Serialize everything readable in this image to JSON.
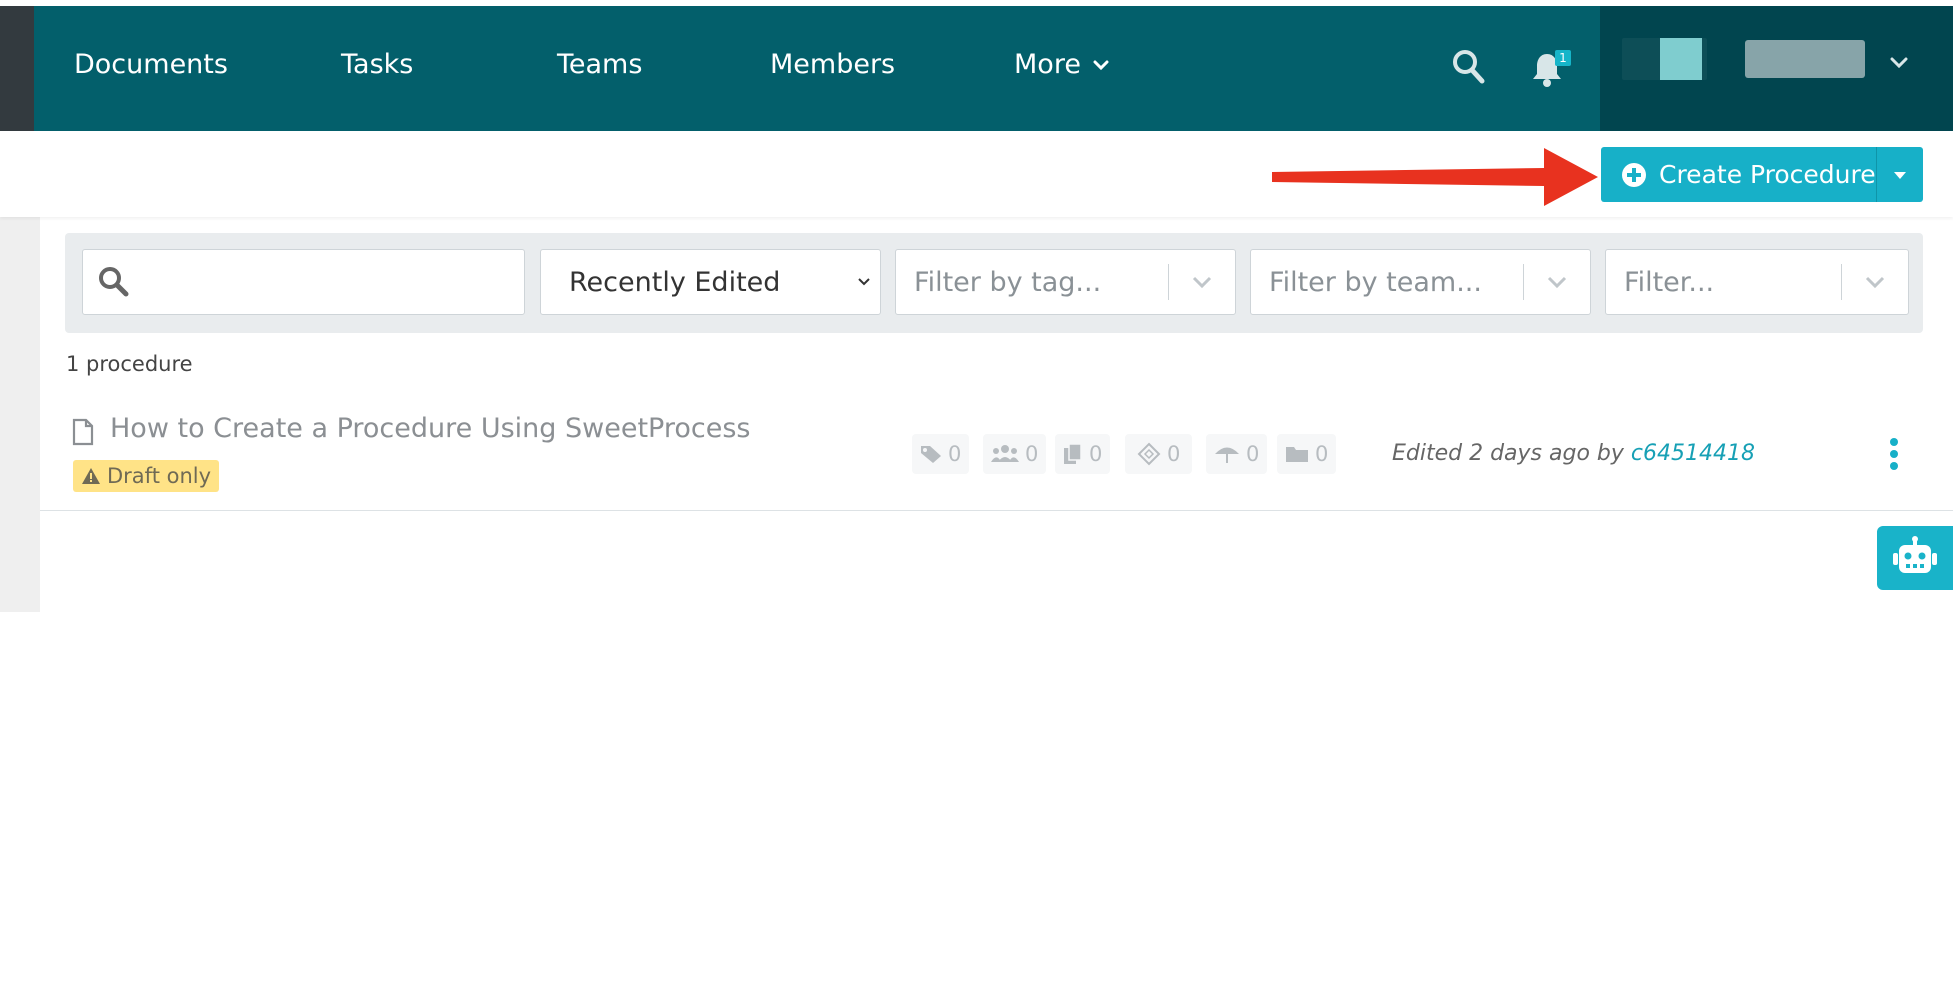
{
  "nav": {
    "items": [
      {
        "label": "Documents"
      },
      {
        "label": "Tasks"
      },
      {
        "label": "Teams"
      },
      {
        "label": "Members"
      }
    ],
    "more_label": "More",
    "notification_count": "1"
  },
  "toolbar": {
    "create_label": "Create Procedure"
  },
  "filters": {
    "search_placeholder": "",
    "sort_value": "Recently Edited",
    "tag_placeholder": "Filter by tag...",
    "team_placeholder": "Filter by team...",
    "other_placeholder": "Filter..."
  },
  "list": {
    "count_text": "1 procedure",
    "items": [
      {
        "title": "How to Create a Procedure Using SweetProcess",
        "badge": "Draft only",
        "stats": {
          "tags": "0",
          "teams": "0",
          "docs": "0",
          "approvals": "0",
          "shares": "0",
          "folders": "0"
        },
        "edited_prefix": "Edited 2 days ago by",
        "edited_by": "c64514418"
      }
    ]
  },
  "colors": {
    "nav_bg": "#035f6b",
    "accent": "#17b0c8",
    "draft_bg": "#ffe387",
    "arrow": "#e8321f"
  }
}
